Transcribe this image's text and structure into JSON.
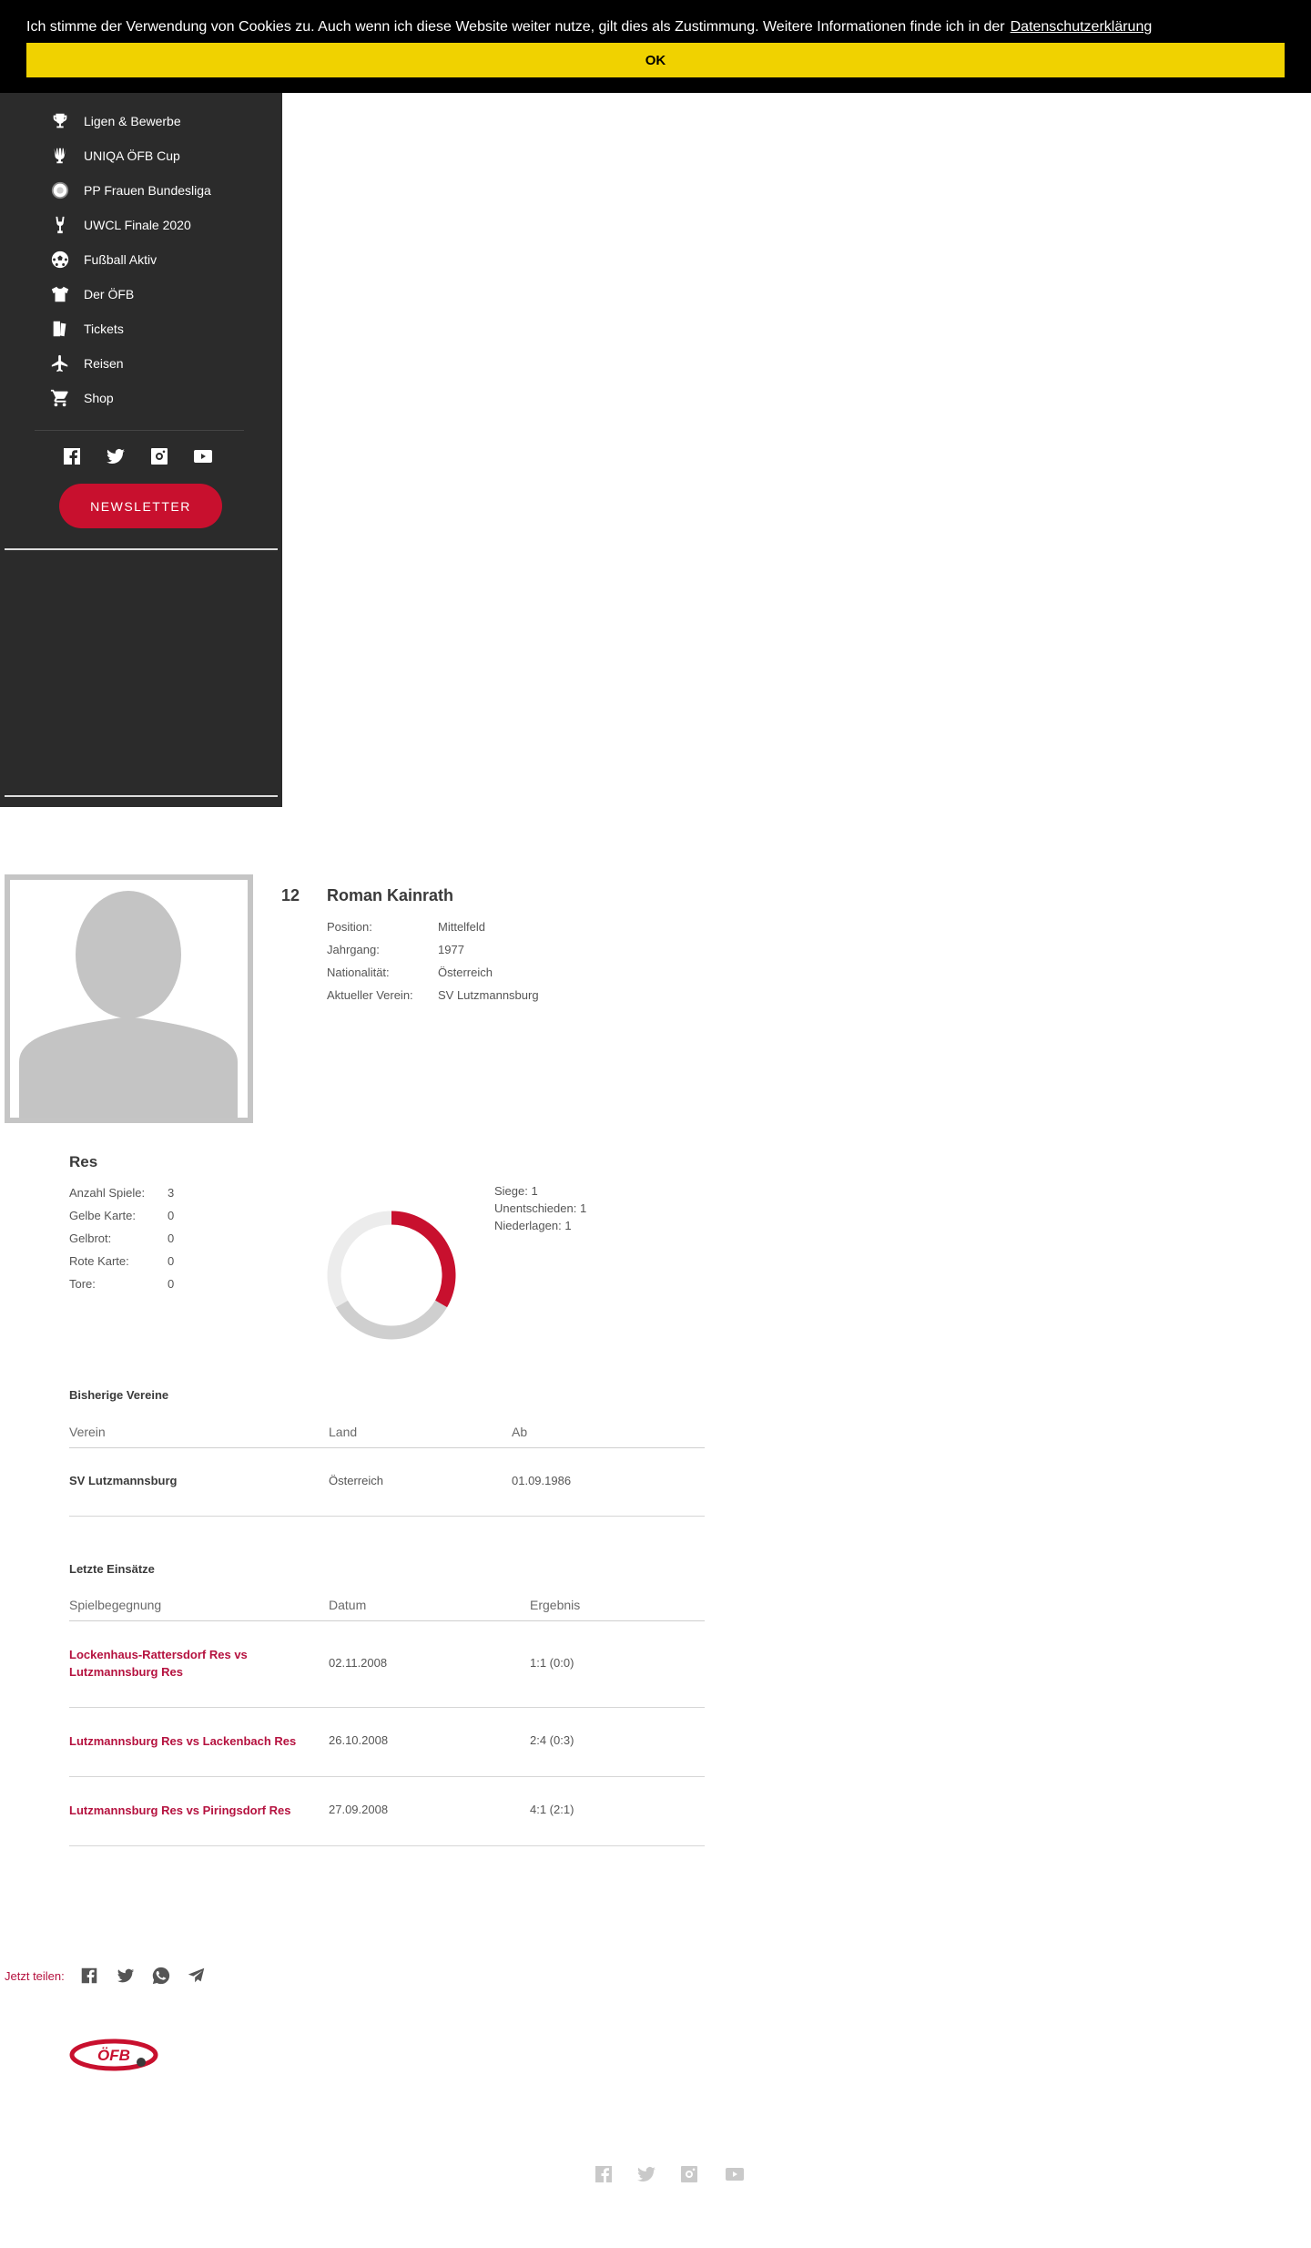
{
  "cookie": {
    "text": "Ich stimme der Verwendung von Cookies zu. Auch wenn ich diese Website weiter nutze, gilt dies als Zustimmung. Weitere Informationen finde ich in der",
    "link": "Datenschutzerklärung",
    "ok": "OK"
  },
  "sidebar": {
    "items": [
      {
        "label": "Ligen & Bewerbe",
        "icon": "trophy-icon"
      },
      {
        "label": "UNIQA ÖFB Cup",
        "icon": "cup-icon"
      },
      {
        "label": "PP Frauen Bundesliga",
        "icon": "ball-badge-icon"
      },
      {
        "label": "UWCL Finale 2020",
        "icon": "uwcl-trophy-icon"
      },
      {
        "label": "Fußball Aktiv",
        "icon": "soccer-ball-icon"
      },
      {
        "label": "Der ÖFB",
        "icon": "jersey-icon"
      },
      {
        "label": "Tickets",
        "icon": "ticket-icon"
      },
      {
        "label": "Reisen",
        "icon": "airplane-icon"
      },
      {
        "label": "Shop",
        "icon": "cart-icon"
      }
    ],
    "newsletter": "NEWSLETTER"
  },
  "player": {
    "number": "12",
    "name": "Roman Kainrath",
    "info": [
      {
        "label": "Position:",
        "value": "Mittelfeld"
      },
      {
        "label": "Jahrgang:",
        "value": "1977"
      },
      {
        "label": "Nationalität:",
        "value": "Österreich"
      },
      {
        "label": "Aktueller Verein:",
        "value": "SV Lutzmannsburg"
      }
    ]
  },
  "stats": {
    "team": "Res",
    "rows": [
      {
        "label": "Anzahl Spiele:",
        "value": "3"
      },
      {
        "label": "Gelbe Karte:",
        "value": "0"
      },
      {
        "label": "Gelbrot:",
        "value": "0"
      },
      {
        "label": "Rote Karte:",
        "value": "0"
      },
      {
        "label": "Tore:",
        "value": "0"
      }
    ],
    "legend": [
      "Siege: 1",
      "Unentschieden: 1",
      "Niederlagen: 1"
    ]
  },
  "chart_data": {
    "type": "pie",
    "categories": [
      "Siege",
      "Unentschieden",
      "Niederlagen"
    ],
    "values": [
      1,
      1,
      1
    ],
    "colors": [
      "#c8102e",
      "#cfcfcf",
      "#ececec"
    ]
  },
  "clubs": {
    "title": "Bisherige Vereine",
    "headers": [
      "Verein",
      "Land",
      "Ab"
    ],
    "rows": [
      {
        "club": "SV Lutzmannsburg",
        "country": "Österreich",
        "since": "01.09.1986"
      }
    ]
  },
  "matches": {
    "title": "Letzte Einsätze",
    "headers": [
      "Spielbegegnung",
      "Datum",
      "Ergebnis"
    ],
    "rows": [
      {
        "match": "Lockenhaus-Rattersdorf Res vs Lutzmannsburg Res",
        "date": "02.11.2008",
        "result": "1:1 (0:0)"
      },
      {
        "match": "Lutzmannsburg Res vs Lackenbach Res",
        "date": "26.10.2008",
        "result": "2:4 (0:3)"
      },
      {
        "match": "Lutzmannsburg Res vs Piringsdorf Res",
        "date": "27.09.2008",
        "result": "4:1 (2:1)"
      }
    ]
  },
  "share": {
    "label": "Jetzt teilen:"
  },
  "logo": {
    "text": "ÖFB",
    "color": "#c8102e"
  }
}
